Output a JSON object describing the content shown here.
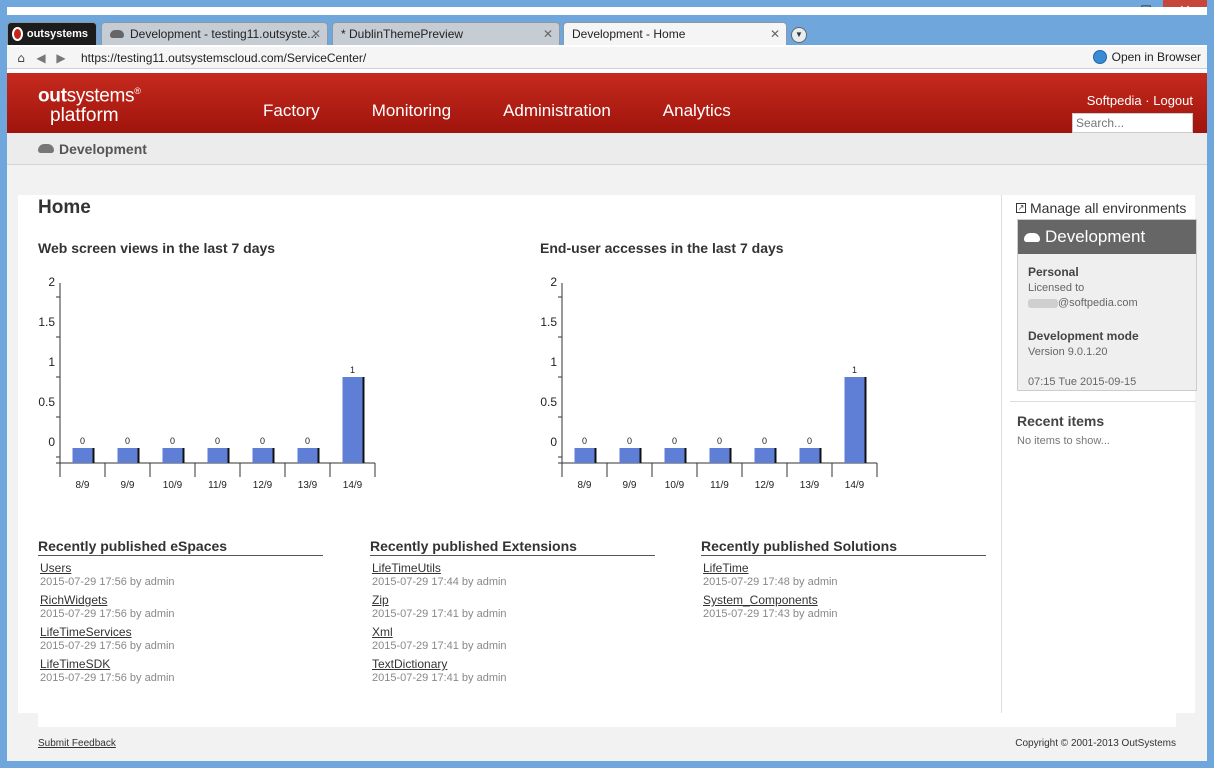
{
  "window": {
    "minimize": "—",
    "maximize": "☐",
    "close": "✕"
  },
  "tabs": [
    {
      "label": "outsystems"
    },
    {
      "label": "Development - testing11.outsyste..."
    },
    {
      "label": "* DublinThemePreview"
    },
    {
      "label": "Development - Home"
    }
  ],
  "address": {
    "url": "https://testing11.outsystemscloud.com/ServiceCenter/",
    "open_in_browser": "Open in Browser"
  },
  "header": {
    "logo_line1_bold": "out",
    "logo_line1_rest": "systems",
    "logo_mark": "®",
    "logo_line2": "platform",
    "nav": [
      "Factory",
      "Monitoring",
      "Administration",
      "Analytics"
    ],
    "user_link": "Softpedia",
    "separator": " · ",
    "logout": "Logout",
    "search_placeholder": "Search..."
  },
  "breadcrumb": {
    "label": "Development"
  },
  "main": {
    "title": "Home",
    "web_views_title": "Web screen views in the last 7 days",
    "end_user_title": "End-user accesses in the last 7 days"
  },
  "chart_data": [
    {
      "type": "bar",
      "title": "Web screen views in the last 7 days",
      "categories": [
        "8/9",
        "9/9",
        "10/9",
        "11/9",
        "12/9",
        "13/9",
        "14/9"
      ],
      "values": [
        0,
        0,
        0,
        0,
        0,
        0,
        1
      ],
      "yticks": [
        "0",
        "0.5",
        "1",
        "1.5",
        "2"
      ],
      "ylim": [
        0,
        2
      ],
      "color": "#5f7fd6"
    },
    {
      "type": "bar",
      "title": "End-user accesses in the last 7 days",
      "categories": [
        "8/9",
        "9/9",
        "10/9",
        "11/9",
        "12/9",
        "13/9",
        "14/9"
      ],
      "values": [
        0,
        0,
        0,
        0,
        0,
        0,
        1
      ],
      "yticks": [
        "0",
        "0.5",
        "1",
        "1.5",
        "2"
      ],
      "ylim": [
        0,
        2
      ],
      "color": "#5f7fd6"
    }
  ],
  "published": {
    "espaces": {
      "title": "Recently published eSpaces",
      "items": [
        {
          "name": "Users",
          "meta": "2015-07-29 17:56 by admin"
        },
        {
          "name": "RichWidgets",
          "meta": "2015-07-29 17:56 by admin"
        },
        {
          "name": "LifeTimeServices",
          "meta": "2015-07-29 17:56 by admin"
        },
        {
          "name": "LifeTimeSDK",
          "meta": "2015-07-29 17:56 by admin"
        }
      ]
    },
    "extensions": {
      "title": "Recently published Extensions",
      "items": [
        {
          "name": "LifeTimeUtils",
          "meta": "2015-07-29 17:44 by admin"
        },
        {
          "name": "Zip",
          "meta": "2015-07-29 17:41 by admin"
        },
        {
          "name": "Xml",
          "meta": "2015-07-29 17:41 by admin"
        },
        {
          "name": "TextDictionary",
          "meta": "2015-07-29 17:41 by admin"
        }
      ]
    },
    "solutions": {
      "title": "Recently published Solutions",
      "items": [
        {
          "name": "LifeTime",
          "meta": "2015-07-29 17:48 by admin"
        },
        {
          "name": "System_Components",
          "meta": "2015-07-29 17:43 by admin"
        }
      ]
    }
  },
  "sidebar": {
    "manage_link": "Manage all environments",
    "env_name": "Development",
    "license_type": "Personal",
    "licensed_to_label": "Licensed to",
    "licensed_email": "@softpedia.com",
    "mode": "Development mode",
    "version": "Version 9.0.1.20",
    "datetime": "07:15 Tue 2015-09-15",
    "recent_title": "Recent items",
    "recent_empty": "No items to show..."
  },
  "footer": {
    "feedback": "Submit Feedback",
    "copyright": "Copyright ©  2001-2013 OutSystems"
  }
}
